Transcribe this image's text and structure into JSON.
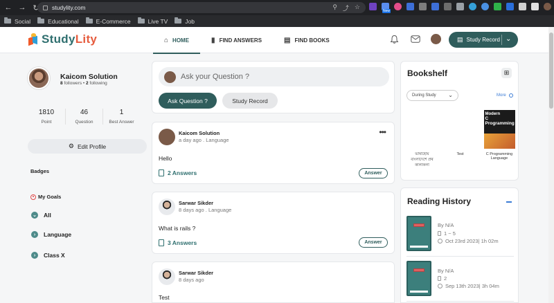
{
  "browser": {
    "url": "studylity.com",
    "new_badge": "New",
    "bookmarks": [
      "Social",
      "Educational",
      "E-Commerce",
      "Live TV",
      "Job"
    ]
  },
  "header": {
    "logo_part1": "Study",
    "logo_part2": "Lity",
    "tabs": [
      {
        "label": "HOME",
        "icon": "home-icon"
      },
      {
        "label": "FIND ANSWERS",
        "icon": "bar-chart-icon"
      },
      {
        "label": "FIND BOOKS",
        "icon": "book-search-icon"
      }
    ],
    "study_record_label": "Study Record"
  },
  "profile": {
    "name": "Kaicom Solution",
    "followers": "8",
    "followers_label": "followers",
    "following": "2",
    "following_label": "following",
    "stats": [
      {
        "value": "1810",
        "label": "Point"
      },
      {
        "value": "46",
        "label": "Question"
      },
      {
        "value": "1",
        "label": "Best Answer"
      }
    ],
    "edit_label": "Edit Profile",
    "badges_label": "Badges",
    "goals_label": "My Goals",
    "goals": [
      "All",
      "Language",
      "Class X"
    ]
  },
  "ask": {
    "placeholder": "Ask your Question ?",
    "ask_button": "Ask Question ?",
    "study_record_button": "Study Record"
  },
  "questions": [
    {
      "author": "Kaicom Solution",
      "meta": "a day ago . Language",
      "text": "Hello",
      "answers": "2 Answers",
      "answer_button": "Answer"
    },
    {
      "author": "Sarwar Sikder",
      "meta": "8 days ago . Language",
      "text": "What is rails ?",
      "answers": "3 Answers",
      "answer_button": "Answer"
    },
    {
      "author": "Sarwar Sikder",
      "meta": "8 days ago",
      "text": "Test"
    }
  ],
  "bookshelf": {
    "title": "Bookshelf",
    "filter": "During Study",
    "more_label": "More",
    "books": [
      {
        "title": "ভাষাহোয় বাংলাদেশে প্রথ কালাকলা"
      },
      {
        "title": "Test"
      },
      {
        "title": "C Programming Language",
        "cover_line1": "Modern",
        "cover_line2": "C",
        "cover_line3": "Programming"
      }
    ]
  },
  "history": {
    "title": "Reading History",
    "items": [
      {
        "by": "By N/A",
        "pages": "1 ~ 5",
        "time": "Oct 23rd 2023| 1h 02m"
      },
      {
        "by": "By N/A",
        "pages": "2",
        "time": "Sep 13th 2023| 3h 04m"
      }
    ]
  }
}
